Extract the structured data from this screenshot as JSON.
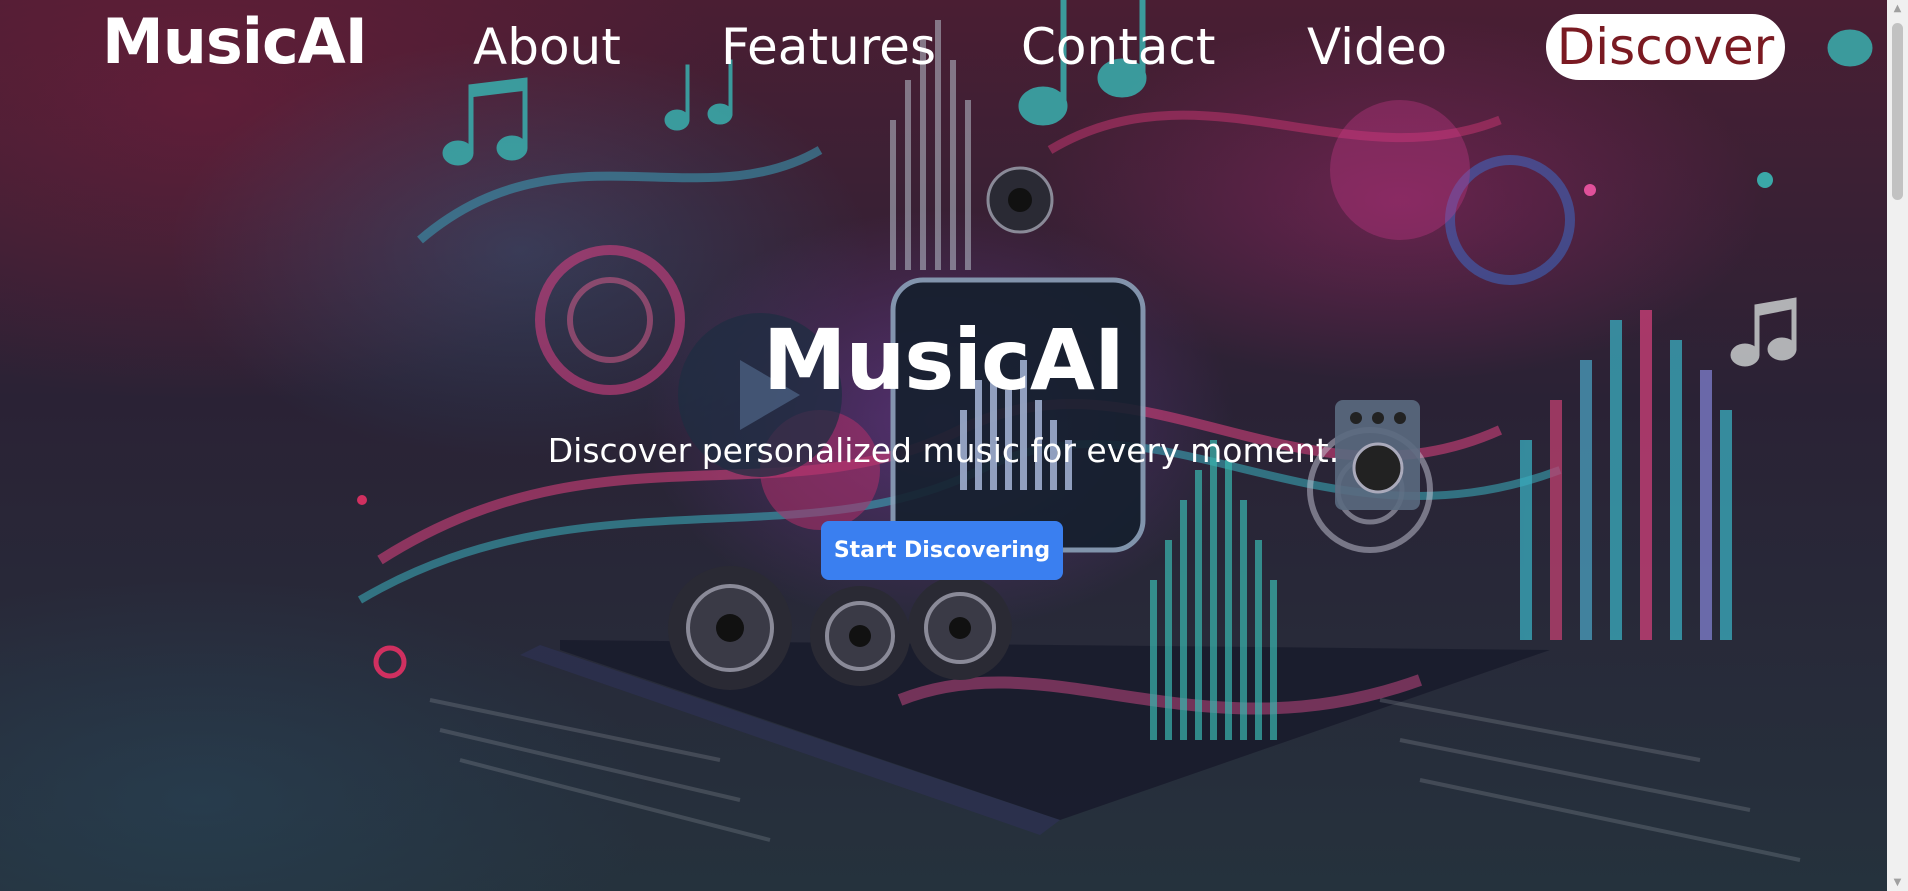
{
  "nav": {
    "logo": "MusicAI",
    "links": [
      "About",
      "Features",
      "Contact",
      "Video"
    ],
    "discover_label": "Discover",
    "discover_text_color": "#7a1a22"
  },
  "hero": {
    "title": "MusicAI",
    "subtitle": "Discover personalized music for every moment.",
    "cta_label": "Start Discovering",
    "cta_color": "#3a7ff0"
  },
  "background": {
    "description_icons": [
      "music-note-icon",
      "speaker-icon",
      "equalizer-bars",
      "play-icon"
    ]
  },
  "scrollbar": {
    "up_glyph": "▲",
    "down_glyph": "▼"
  }
}
